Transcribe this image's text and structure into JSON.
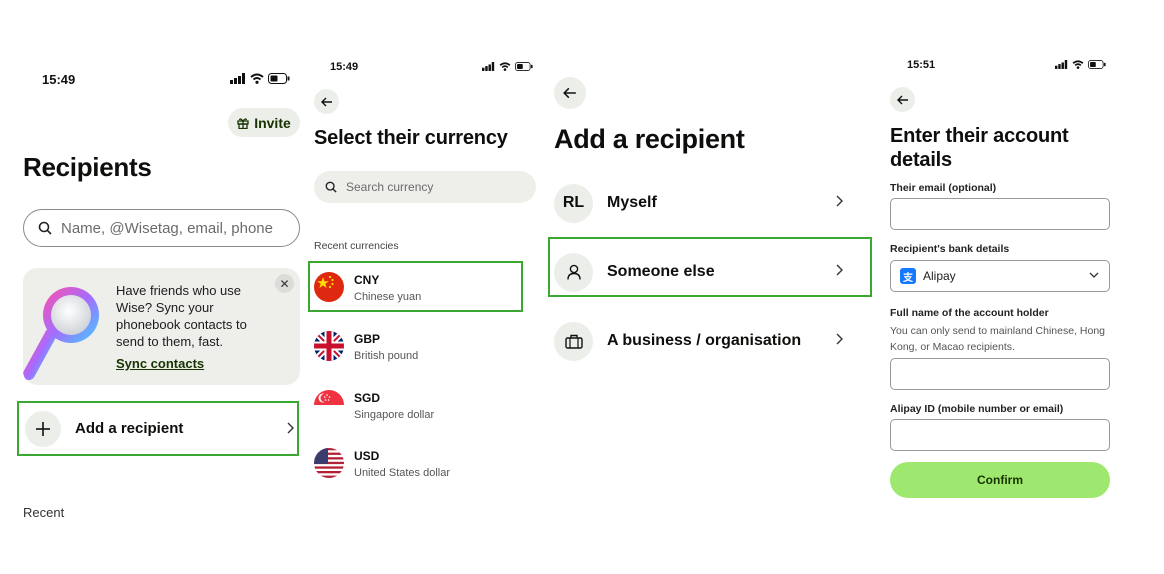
{
  "colors": {
    "accent_green": "#9fe870",
    "highlight_green": "#3aa832",
    "forest": "#163300",
    "chip_bg": "#eceee9"
  },
  "screen1": {
    "time": "15:49",
    "invite_label": "Invite",
    "title": "Recipients",
    "search_placeholder": "Name, @Wisetag, email, phone",
    "promo_text": "Have friends who use Wise? Sync your phonebook contacts to send to them, fast.",
    "promo_link": "Sync contacts",
    "add_label": "Add a recipient",
    "recent_label": "Recent"
  },
  "screen2": {
    "time": "15:49",
    "title": "Select their currency",
    "search_placeholder": "Search currency",
    "recent_label": "Recent currencies",
    "currencies": [
      {
        "code": "CNY",
        "name": "Chinese yuan",
        "flag": "china-flag"
      },
      {
        "code": "GBP",
        "name": "British pound",
        "flag": "uk-flag"
      },
      {
        "code": "SGD",
        "name": "Singapore dollar",
        "flag": "singapore-flag"
      },
      {
        "code": "USD",
        "name": "United States dollar",
        "flag": "usa-flag"
      }
    ],
    "selected": "CNY"
  },
  "screen3": {
    "title": "Add a recipient",
    "options": [
      {
        "avatar_text": "RL",
        "label": "Myself"
      },
      {
        "icon": "person-icon",
        "label": "Someone else"
      },
      {
        "icon": "briefcase-icon",
        "label": "A business / organisation"
      }
    ],
    "selected": "Someone else"
  },
  "screen4": {
    "time": "15:51",
    "title": "Enter their account details",
    "email_label": "Their email (optional)",
    "bank_label": "Recipient's bank details",
    "bank_value": "Alipay",
    "fullname_label": "Full name of the account holder",
    "fullname_help": "You can only send to mainland Chinese, Hong Kong, or Macao recipients.",
    "alipay_label": "Alipay ID (mobile number or email)",
    "confirm_label": "Confirm"
  }
}
